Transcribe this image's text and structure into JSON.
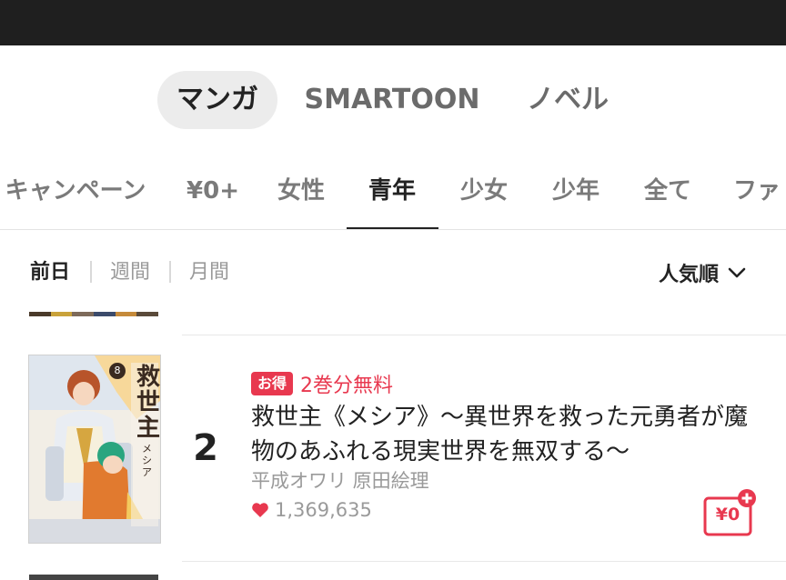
{
  "top_tabs": [
    {
      "label": "マンガ",
      "active": true
    },
    {
      "label": "SMARTOON",
      "active": false
    },
    {
      "label": "ノベル",
      "active": false
    }
  ],
  "category_tabs": [
    {
      "label": "キャンペーン"
    },
    {
      "label": "¥0+"
    },
    {
      "label": "女性"
    },
    {
      "label": "青年",
      "active": true
    },
    {
      "label": "少女"
    },
    {
      "label": "少年"
    },
    {
      "label": "全て"
    },
    {
      "label": "ファ"
    }
  ],
  "period_tabs": [
    {
      "label": "前日",
      "active": true
    },
    {
      "label": "週間"
    },
    {
      "label": "月間"
    }
  ],
  "sort": {
    "label": "人気順"
  },
  "ranking_item": {
    "rank": "2",
    "badge": "お得",
    "badge_text": "2巻分無料",
    "title": "救世主《メシア》～異世界を救った元勇者が魔物のあふれる現実世界を無双する～",
    "authors": "平成オワリ 原田絵理",
    "likes": "1,369,635",
    "yen_button_label": "¥0",
    "cover_title": "救世主",
    "cover_subtitle": "メシア",
    "cover_volume": "8"
  },
  "colors": {
    "accent": "#e8384f",
    "status_bar": "#1f1f1f",
    "active_pill": "#ececec"
  }
}
